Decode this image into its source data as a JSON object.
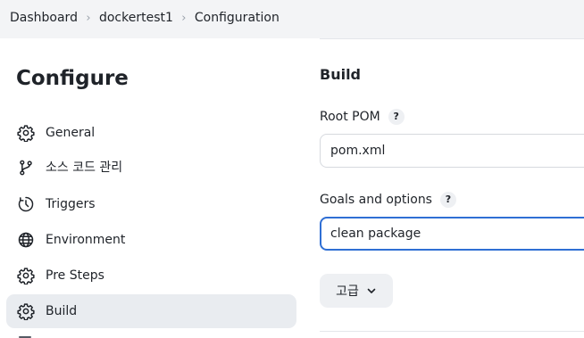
{
  "breadcrumb": {
    "items": [
      "Dashboard",
      "dockertest1",
      "Configuration"
    ]
  },
  "sidebar": {
    "title": "Configure",
    "items": [
      {
        "label": "General",
        "icon": "gear-icon"
      },
      {
        "label": "소스 코드 관리",
        "icon": "branch-icon"
      },
      {
        "label": "Triggers",
        "icon": "clock-icon"
      },
      {
        "label": "Environment",
        "icon": "globe-icon"
      },
      {
        "label": "Pre Steps",
        "icon": "gear-icon"
      },
      {
        "label": "Build",
        "icon": "gear-icon",
        "active": true
      }
    ]
  },
  "main": {
    "section_title": "Build",
    "root_pom": {
      "label": "Root POM",
      "help": "?",
      "value": "pom.xml"
    },
    "goals": {
      "label": "Goals and options",
      "help": "?",
      "value": "clean package"
    },
    "advanced_button": {
      "label": "고급",
      "icon": "chevron-down-icon"
    }
  },
  "colors": {
    "focus_border": "#2f6fd4",
    "active_nav_bg": "#e9ecf0",
    "topbar_bg": "#f3f4f6"
  }
}
